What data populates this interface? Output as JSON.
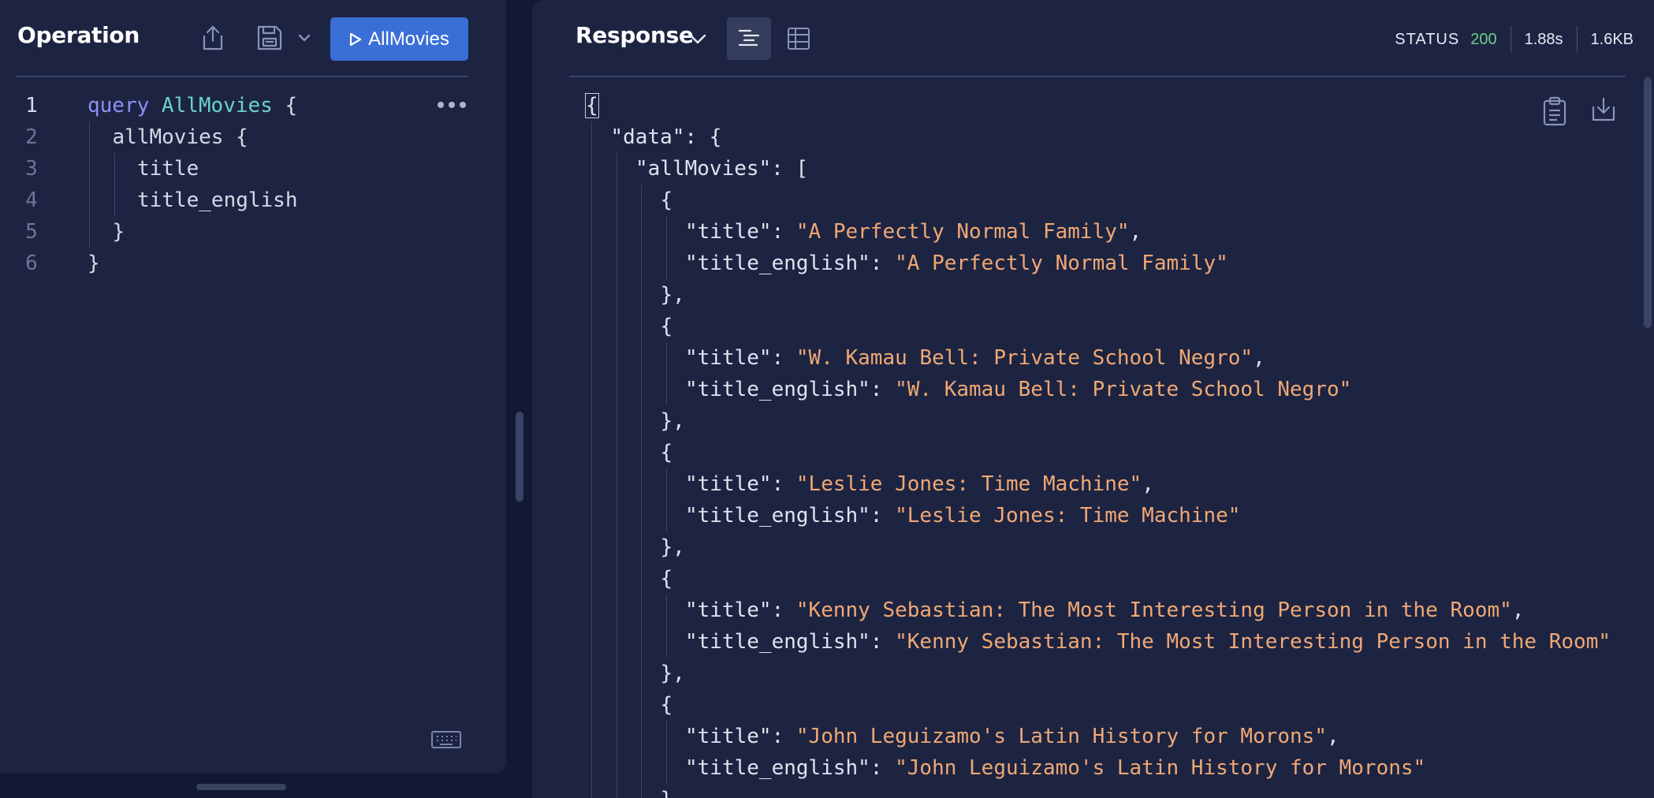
{
  "operation": {
    "title": "Operation",
    "run_label": "AllMovies",
    "lines": [
      {
        "num": "1",
        "indent": 0,
        "parts": [
          {
            "t": "query ",
            "c": "kw"
          },
          {
            "t": "AllMovies",
            "c": "fn"
          },
          {
            "t": " {",
            "c": ""
          }
        ]
      },
      {
        "num": "2",
        "indent": 1,
        "parts": [
          {
            "t": "allMovies {",
            "c": ""
          }
        ]
      },
      {
        "num": "3",
        "indent": 2,
        "parts": [
          {
            "t": "title",
            "c": ""
          }
        ]
      },
      {
        "num": "4",
        "indent": 2,
        "parts": [
          {
            "t": "title_english",
            "c": ""
          }
        ]
      },
      {
        "num": "5",
        "indent": 1,
        "parts": [
          {
            "t": "}",
            "c": ""
          }
        ]
      },
      {
        "num": "6",
        "indent": 0,
        "parts": [
          {
            "t": "}",
            "c": ""
          }
        ]
      }
    ]
  },
  "response": {
    "title": "Response",
    "status_label": "STATUS",
    "status_code": "200",
    "time": "1.88s",
    "size": "1.6KB",
    "lines": [
      {
        "indent": 0,
        "parts": [
          {
            "t": "{",
            "c": "cursor"
          }
        ]
      },
      {
        "indent": 1,
        "parts": [
          {
            "t": "\"data\": {",
            "c": ""
          }
        ]
      },
      {
        "indent": 2,
        "parts": [
          {
            "t": "\"allMovies\": [",
            "c": ""
          }
        ]
      },
      {
        "indent": 3,
        "parts": [
          {
            "t": "{",
            "c": ""
          }
        ]
      },
      {
        "indent": 4,
        "parts": [
          {
            "t": "\"title\": ",
            "c": ""
          },
          {
            "t": "\"A Perfectly Normal Family\"",
            "c": "str"
          },
          {
            "t": ",",
            "c": ""
          }
        ]
      },
      {
        "indent": 4,
        "parts": [
          {
            "t": "\"title_english\": ",
            "c": ""
          },
          {
            "t": "\"A Perfectly Normal Family\"",
            "c": "str"
          }
        ]
      },
      {
        "indent": 3,
        "parts": [
          {
            "t": "},",
            "c": ""
          }
        ]
      },
      {
        "indent": 3,
        "parts": [
          {
            "t": "{",
            "c": ""
          }
        ]
      },
      {
        "indent": 4,
        "parts": [
          {
            "t": "\"title\": ",
            "c": ""
          },
          {
            "t": "\"W. Kamau Bell: Private School Negro\"",
            "c": "str"
          },
          {
            "t": ",",
            "c": ""
          }
        ]
      },
      {
        "indent": 4,
        "parts": [
          {
            "t": "\"title_english\": ",
            "c": ""
          },
          {
            "t": "\"W. Kamau Bell: Private School Negro\"",
            "c": "str"
          }
        ]
      },
      {
        "indent": 3,
        "parts": [
          {
            "t": "},",
            "c": ""
          }
        ]
      },
      {
        "indent": 3,
        "parts": [
          {
            "t": "{",
            "c": ""
          }
        ]
      },
      {
        "indent": 4,
        "parts": [
          {
            "t": "\"title\": ",
            "c": ""
          },
          {
            "t": "\"Leslie Jones: Time Machine\"",
            "c": "str"
          },
          {
            "t": ",",
            "c": ""
          }
        ]
      },
      {
        "indent": 4,
        "parts": [
          {
            "t": "\"title_english\": ",
            "c": ""
          },
          {
            "t": "\"Leslie Jones: Time Machine\"",
            "c": "str"
          }
        ]
      },
      {
        "indent": 3,
        "parts": [
          {
            "t": "},",
            "c": ""
          }
        ]
      },
      {
        "indent": 3,
        "parts": [
          {
            "t": "{",
            "c": ""
          }
        ]
      },
      {
        "indent": 4,
        "parts": [
          {
            "t": "\"title\": ",
            "c": ""
          },
          {
            "t": "\"Kenny Sebastian: The Most Interesting Person in the Room\"",
            "c": "str"
          },
          {
            "t": ",",
            "c": ""
          }
        ]
      },
      {
        "indent": 4,
        "parts": [
          {
            "t": "\"title_english\": ",
            "c": ""
          },
          {
            "t": "\"Kenny Sebastian: The Most Interesting Person in the Room\"",
            "c": "str"
          }
        ]
      },
      {
        "indent": 3,
        "parts": [
          {
            "t": "},",
            "c": ""
          }
        ]
      },
      {
        "indent": 3,
        "parts": [
          {
            "t": "{",
            "c": ""
          }
        ]
      },
      {
        "indent": 4,
        "parts": [
          {
            "t": "\"title\": ",
            "c": ""
          },
          {
            "t": "\"John Leguizamo's Latin History for Morons\"",
            "c": "str"
          },
          {
            "t": ",",
            "c": ""
          }
        ]
      },
      {
        "indent": 4,
        "parts": [
          {
            "t": "\"title_english\": ",
            "c": ""
          },
          {
            "t": "\"John Leguizamo's Latin History for Morons\"",
            "c": "str"
          }
        ]
      },
      {
        "indent": 3,
        "parts": [
          {
            "t": "},",
            "c": ""
          }
        ]
      }
    ]
  },
  "icons": {
    "share": "share-icon",
    "save": "save-icon",
    "dropdown": "chevron-down-icon",
    "play": "play-icon",
    "more": "more-horizontal-icon",
    "keyboard": "keyboard-icon",
    "json_view": "json-view-icon",
    "table_view": "table-view-icon",
    "copy": "clipboard-icon",
    "download": "download-icon"
  },
  "colors": {
    "accent": "#3a6fd6",
    "status_ok": "#6fcf8b",
    "keyword": "#8f8ff2",
    "operation_name": "#69d3c4",
    "string": "#f0a874"
  }
}
